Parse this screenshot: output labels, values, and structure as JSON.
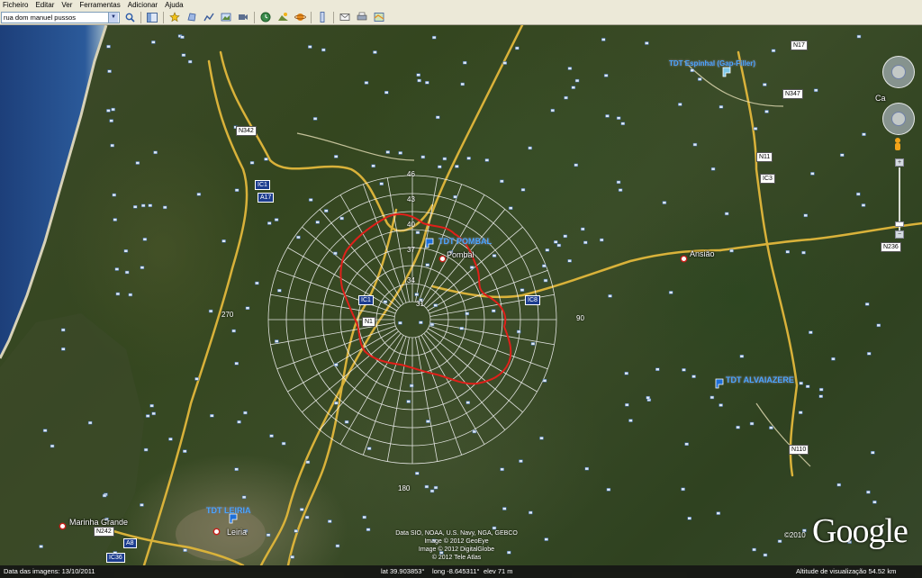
{
  "menu": {
    "items": [
      "Ficheiro",
      "Editar",
      "Ver",
      "Ferramentas",
      "Adicionar",
      "Ajuda"
    ]
  },
  "toolbar": {
    "search_value": "rua dom manuel pussos",
    "buttons": [
      "search",
      "sidebar-toggle",
      "placemark",
      "polygon",
      "path",
      "image-overlay",
      "record-tour",
      "historical-imagery",
      "sunlight",
      "planets",
      "ruler",
      "email",
      "print",
      "view-in-google-maps"
    ]
  },
  "map": {
    "places": {
      "pombal": "Pombal",
      "ansiao": "Ansião",
      "leiria": "Leiria",
      "marinha_grande": "Marinha Grande",
      "ca_partial": "Ca"
    },
    "transmitters": {
      "pombal": "TDT POMBAL",
      "espinhal": "TDT Espinhal (Gap-Filler)",
      "alvaiazere": "TDT ALVAIAZERE",
      "leiria": "TDT LEIRIA"
    },
    "roads": [
      "A17",
      "IC1",
      "IC1",
      "IC8",
      "N1",
      "IC3",
      "N11",
      "N347",
      "N17",
      "N236",
      "N110",
      "N342",
      "A8",
      "IC36",
      "N242"
    ],
    "ring_labels": [
      "46",
      "43",
      "40",
      "37",
      "34",
      "31"
    ],
    "bearing_labels": {
      "east": "90",
      "west": "270",
      "south": "180"
    }
  },
  "attribution": [
    "Data SIO, NOAA, U.S. Navy, NGA, GEBCO",
    "Image © 2012 GeoEye",
    "Image © 2012 DigitalGlobe",
    "© 2012 Tele Atlas"
  ],
  "logo": "Google",
  "copyright_year": "©2010",
  "statusbar": {
    "imagery_date": "Data das imagens: 13/10/2011",
    "lat": "lat  39.903853°",
    "lon": "long  -8.645311°",
    "elev": "elev  71 m",
    "eye_alt": "Altitude de visualização   54.52 km"
  }
}
